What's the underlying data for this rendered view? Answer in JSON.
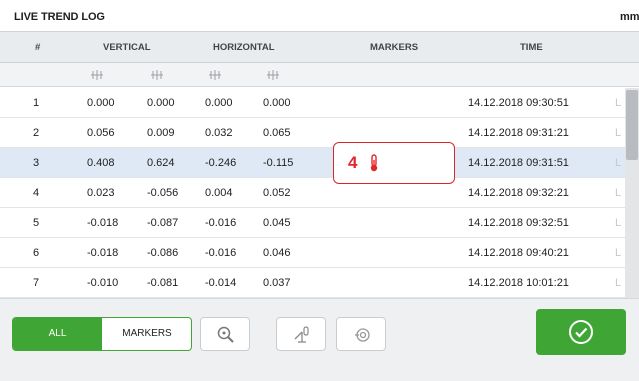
{
  "header": {
    "title": "LIVE TREND LOG",
    "unit": "mm"
  },
  "columns": {
    "num": "#",
    "vertical": "VERTICAL",
    "horizontal": "HORIZONTAL",
    "markers": "MARKERS",
    "time": "TIME"
  },
  "rows": [
    {
      "num": "1",
      "v1": "0.000",
      "v2": "0.000",
      "h1": "0.000",
      "h2": "0.000",
      "time": "14.12.2018 09:30:51",
      "tail": "L"
    },
    {
      "num": "2",
      "v1": "0.056",
      "v2": "0.009",
      "h1": "0.032",
      "h2": "0.065",
      "time": "14.12.2018 09:31:21",
      "tail": "L"
    },
    {
      "num": "3",
      "v1": "0.408",
      "v2": "0.624",
      "h1": "-0.246",
      "h2": "-0.115",
      "time": "14.12.2018 09:31:51",
      "tail": "L"
    },
    {
      "num": "4",
      "v1": "0.023",
      "v2": "-0.056",
      "h1": "0.004",
      "h2": "0.052",
      "time": "14.12.2018 09:32:21",
      "tail": "L"
    },
    {
      "num": "5",
      "v1": "-0.018",
      "v2": "-0.087",
      "h1": "-0.016",
      "h2": "0.045",
      "time": "14.12.2018 09:32:51",
      "tail": "L"
    },
    {
      "num": "6",
      "v1": "-0.018",
      "v2": "-0.086",
      "h1": "-0.016",
      "h2": "0.046",
      "time": "14.12.2018 09:40:21",
      "tail": "L"
    },
    {
      "num": "7",
      "v1": "-0.010",
      "v2": "-0.081",
      "h1": "-0.014",
      "h2": "0.037",
      "time": "14.12.2018 10:01:21",
      "tail": "L"
    }
  ],
  "marker": {
    "row": "3",
    "number": "4",
    "icon": "thermometer-icon",
    "color": "#e3262b"
  },
  "footer": {
    "all_label": "ALL",
    "markers_label": "MARKERS",
    "accent": "#3fa535"
  }
}
